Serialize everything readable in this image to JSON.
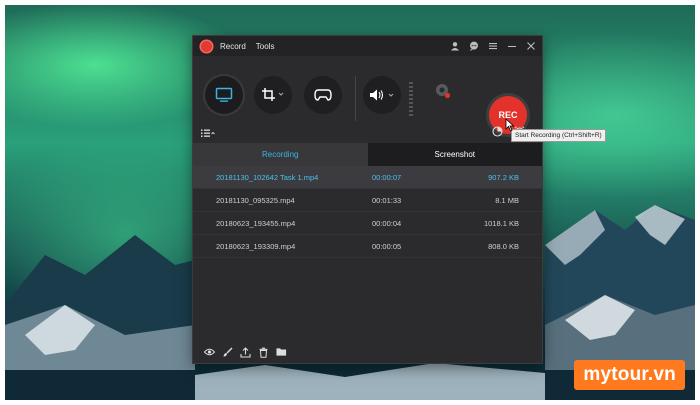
{
  "menu": {
    "record": "Record",
    "tools": "Tools"
  },
  "titlebar_icons": [
    "account-icon",
    "chat-icon",
    "hamburger-menu-icon",
    "minimize-icon",
    "close-icon"
  ],
  "toolbar": {
    "rec_label": "REC",
    "tooltip": "Start Recording (Ctrl+Shift+R)"
  },
  "tabs": [
    {
      "label": "Recording",
      "active": true
    },
    {
      "label": "Screenshot",
      "active": false
    }
  ],
  "files": [
    {
      "name": "20181130_102642 Task 1.mp4",
      "duration": "00:00:07",
      "size": "907.2 KB",
      "selected": true
    },
    {
      "name": "20181130_095325.mp4",
      "duration": "00:01:33",
      "size": "8.1 MB",
      "selected": false
    },
    {
      "name": "20180623_193455.mp4",
      "duration": "00:00:04",
      "size": "1018.1 KB",
      "selected": false
    },
    {
      "name": "20180623_193309.mp4",
      "duration": "00:00:05",
      "size": "808.0 KB",
      "selected": false
    }
  ],
  "bottom_icons": [
    "preview-eye-icon",
    "edit-brush-icon",
    "upload-icon",
    "delete-trash-icon",
    "open-folder-icon"
  ],
  "watermark": "mytour.vn",
  "colors": {
    "accent": "#3ab3e6",
    "record": "#e3322b",
    "watermark": "#ff7a1f"
  }
}
